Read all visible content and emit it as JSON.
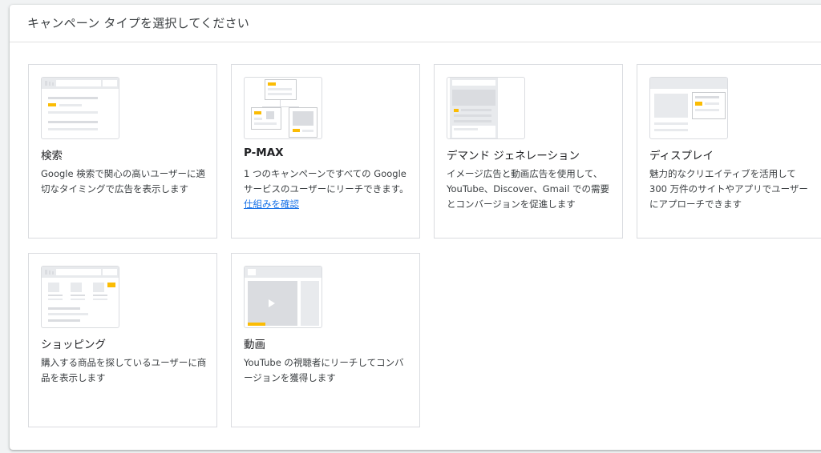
{
  "header": {
    "title": "キャンペーン タイプを選択してください"
  },
  "cards": [
    {
      "title": "検索",
      "description": "Google 検索で関心の高いユーザーに適切なタイミングで広告を表示します"
    },
    {
      "title": "P-MAX",
      "description": "1 つのキャンペーンですべての Google サービスのユーザーにリーチできます。",
      "link": "仕組みを確認"
    },
    {
      "title": "デマンド ジェネレーション",
      "description": "イメージ広告と動画広告を使用して、YouTube、Discover、Gmail での需要とコンバージョンを促進します"
    },
    {
      "title": "ディスプレイ",
      "description": "魅力的なクリエイティブを活用して 300 万件のサイトやアプリでユーザーにアプローチできます"
    },
    {
      "title": "ショッピング",
      "description": "購入する商品を探しているユーザーに商品を表示します"
    },
    {
      "title": "動画",
      "description": "YouTube の視聴者にリーチしてコンバージョンを獲得します"
    }
  ],
  "colors": {
    "accent": "#fbbc04",
    "link": "#1a73e8",
    "border": "#dadce0"
  },
  "icons": {
    "play": "play-icon"
  }
}
